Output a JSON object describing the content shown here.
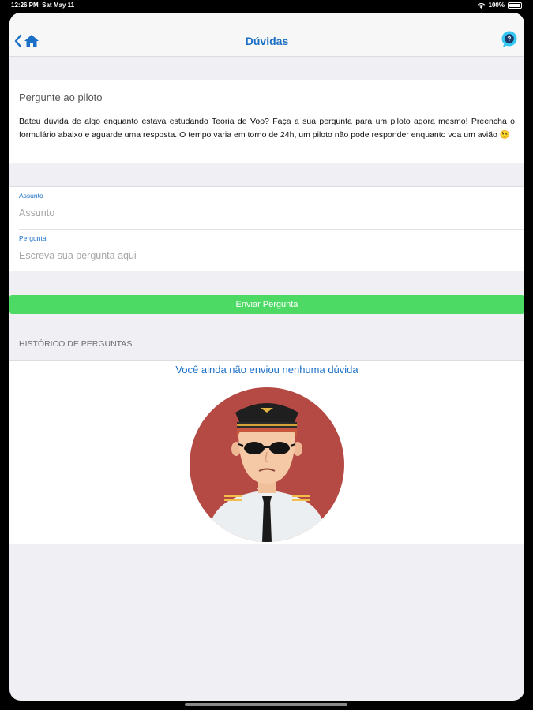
{
  "status": {
    "time": "12:26 PM",
    "date": "Sat May 11",
    "battery": "100%"
  },
  "nav": {
    "title": "Dúvidas"
  },
  "intro": {
    "title": "Pergunte ao piloto",
    "body": "Bateu dúvida de algo enquanto estava estudando Teoria de Voo? Faça a sua pergunta para um piloto agora mesmo! Preencha o formulário abaixo e aguarde uma resposta. O tempo varia em torno de 24h, um piloto não pode responder enquanto voa um avião 😉"
  },
  "form": {
    "subject": {
      "label": "Assunto",
      "placeholder": "Assunto",
      "value": ""
    },
    "question": {
      "label": "Pergunta",
      "placeholder": "Escreva sua pergunta aqui",
      "value": ""
    }
  },
  "send_label": "Enviar Pergunta",
  "history": {
    "header": "HISTÓRICO DE PERGUNTAS",
    "empty_message": "Você ainda não enviou nenhuma dúvida"
  },
  "icons": {
    "back": "chevron-left-icon",
    "home": "home-icon",
    "help": "help-bubble-icon",
    "wifi": "wifi-icon",
    "battery": "battery-icon"
  },
  "colors": {
    "accent": "#1b6fc6",
    "send_button": "#4cd964",
    "help_icon": "#35c6f2",
    "pilot_circle": "#b54a45"
  }
}
